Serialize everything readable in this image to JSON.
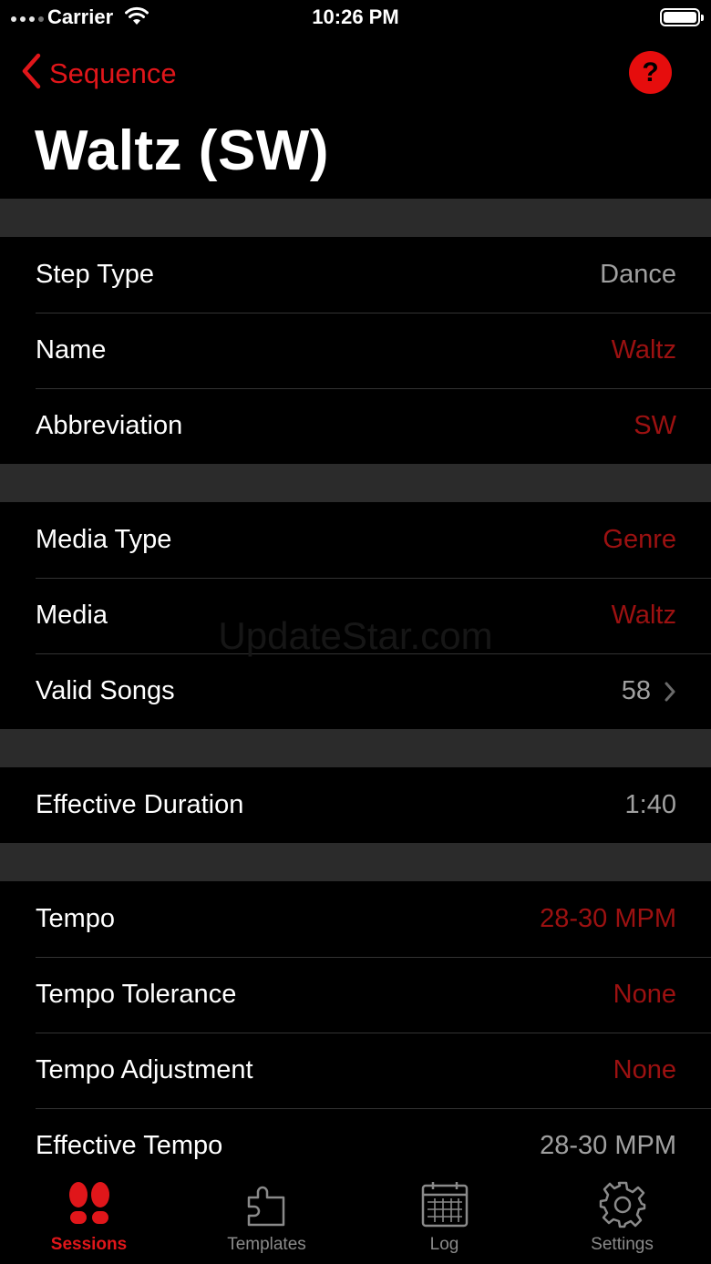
{
  "status_bar": {
    "carrier": "Carrier",
    "time": "10:26 PM"
  },
  "nav": {
    "back_label": "Sequence",
    "help_symbol": "?"
  },
  "page_title": "Waltz (SW)",
  "groups": [
    [
      {
        "label": "Step Type",
        "value": "Dance",
        "accent": false
      },
      {
        "label": "Name",
        "value": "Waltz",
        "accent": true
      },
      {
        "label": "Abbreviation",
        "value": "SW",
        "accent": true
      }
    ],
    [
      {
        "label": "Media Type",
        "value": "Genre",
        "accent": true
      },
      {
        "label": "Media",
        "value": "Waltz",
        "accent": true
      },
      {
        "label": "Valid Songs",
        "value": "58",
        "accent": false,
        "disclosure": true
      }
    ],
    [
      {
        "label": "Effective Duration",
        "value": "1:40",
        "accent": false
      }
    ],
    [
      {
        "label": "Tempo",
        "value": "28-30 MPM",
        "accent": true
      },
      {
        "label": "Tempo Tolerance",
        "value": "None",
        "accent": true
      },
      {
        "label": "Tempo Adjustment",
        "value": "None",
        "accent": true
      },
      {
        "label": "Effective Tempo",
        "value": "28-30 MPM",
        "accent": false
      }
    ]
  ],
  "watermark": "UpdateStar.com",
  "tabs": [
    {
      "label": "Sessions",
      "icon": "footprints-icon",
      "active": true
    },
    {
      "label": "Templates",
      "icon": "puzzle-icon",
      "active": false
    },
    {
      "label": "Log",
      "icon": "calendar-icon",
      "active": false
    },
    {
      "label": "Settings",
      "icon": "gear-icon",
      "active": false
    }
  ],
  "colors": {
    "accent": "#e0161a",
    "accent_value": "#9c1111",
    "separator": "#2b2b2b"
  }
}
